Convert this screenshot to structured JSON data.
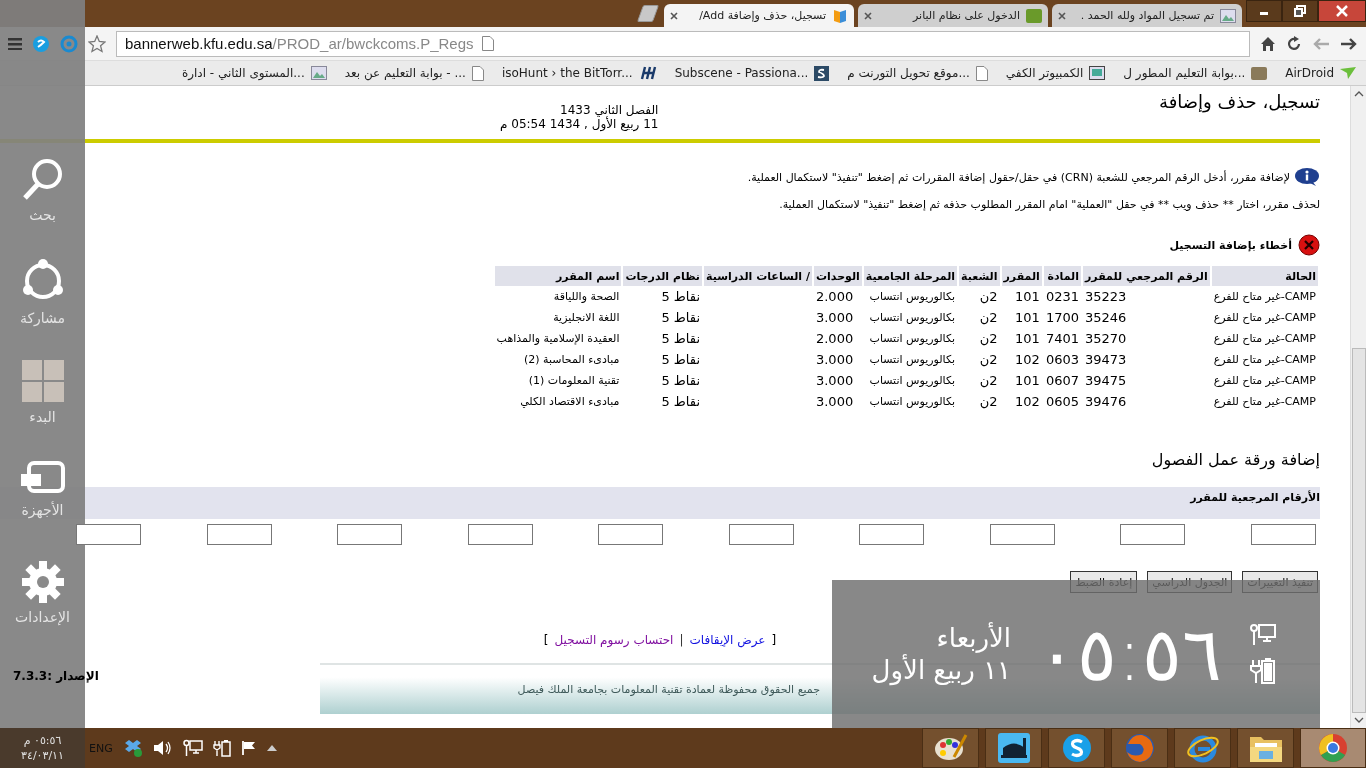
{
  "browser": {
    "tabs": [
      {
        "title": "تم تسجيل المواد ولله الحمد .",
        "selected": false,
        "kind": "image"
      },
      {
        "title": "الدخول على نظام البانر",
        "selected": false,
        "kind": "site"
      },
      {
        "title": "تسجيل، حذف وإضافة Add/",
        "selected": true,
        "kind": "book"
      }
    ],
    "address": {
      "host": "bannerweb.kfu.edu.sa",
      "path": "/PROD_ar/bwckcoms.P_Regs"
    },
    "bookmarks": [
      {
        "title": "AirDroid",
        "kind": "airdroid"
      },
      {
        "title": "بوابة التعليم المطور ل...",
        "kind": "bb"
      },
      {
        "title": "الكمبيوتر الكفي",
        "kind": "tablet"
      },
      {
        "title": "موقع تحويل التورنت م...",
        "kind": "page"
      },
      {
        "title": "Subscene - Passiona...",
        "kind": "subscene"
      },
      {
        "title": "isoHunt › the BitTorr...",
        "kind": "isohunt"
      },
      {
        "title": "بوابة التعليم عن بعد - ...",
        "kind": "page"
      },
      {
        "title": "المستوى الثاني - ادارة...",
        "kind": "image"
      }
    ]
  },
  "page": {
    "title": "تسجيل، حذف وإضافة",
    "term": "الفصل الثاني 1433",
    "date": "11 ربيع الأول , 1434 05:54 م",
    "info": [
      "لإضافة مقرر، أدخل الرقم المرجعي للشعبة (CRN) في حقل/حقول إضافة المقررات ثم إضغط \"تنفيذ\" لاستكمال العملية.",
      "لحذف مقرر، اختار ** حذف ويب ** في حقل \"العملية\" امام المقرر المطلوب حذفه ثم إضغط \"تنفيذ\" لاستكمال العملية."
    ],
    "error_title": "أخطاء بإضافة التسجيل",
    "table": {
      "columns": [
        "الحالة",
        "الرقم المرجعي للمقرر",
        "المادة",
        "المقرر",
        "الشعبة",
        "المرحلة الجامعية",
        "الوحدات",
        "/ الساعات الدراسية",
        "نظام الدرجات",
        "اسم المقرر"
      ],
      "rows": [
        {
          "status": "CAMP-غير متاح للفرع",
          "crn": "35223",
          "subject": "0231",
          "course": "101",
          "section": "2ن",
          "level": "بكالوريوس انتساب",
          "credits": "2.000",
          "grading": "نقاط 5",
          "title": "الصحة واللياقة"
        },
        {
          "status": "CAMP-غير متاح للفرع",
          "crn": "35246",
          "subject": "1700",
          "course": "101",
          "section": "2ن",
          "level": "بكالوريوس انتساب",
          "credits": "3.000",
          "grading": "نقاط 5",
          "title": "اللغة الانجليزية"
        },
        {
          "status": "CAMP-غير متاح للفرع",
          "crn": "35270",
          "subject": "7401",
          "course": "101",
          "section": "2ن",
          "level": "بكالوريوس انتساب",
          "credits": "2.000",
          "grading": "نقاط 5",
          "title": "العقيدة الإسلامية والمذاهب"
        },
        {
          "status": "CAMP-غير متاح للفرع",
          "crn": "39473",
          "subject": "0603",
          "course": "102",
          "section": "2ن",
          "level": "بكالوريوس انتساب",
          "credits": "3.000",
          "grading": "نقاط 5",
          "title": "مبادىء المحاسبة (2)"
        },
        {
          "status": "CAMP-غير متاح للفرع",
          "crn": "39475",
          "subject": "0607",
          "course": "101",
          "section": "2ن",
          "level": "بكالوريوس انتساب",
          "credits": "3.000",
          "grading": "نقاط 5",
          "title": "تقنية المعلومات (1)"
        },
        {
          "status": "CAMP-غير متاح للفرع",
          "crn": "39476",
          "subject": "0605",
          "course": "102",
          "section": "2ن",
          "level": "بكالوريوس انتساب",
          "credits": "3.000",
          "grading": "نقاط 5",
          "title": "مبادىء الاقتصاد الكلي"
        }
      ]
    },
    "worksheet_title": "إضافة ورقة عمل الفصول",
    "crn_label": "الأرقام المرجعية للمقرر",
    "crn_fields": [
      {
        "kind": "text"
      },
      {
        "kind": "text"
      },
      {
        "kind": "text"
      },
      {
        "kind": "text"
      },
      {
        "kind": "text"
      },
      {
        "kind": "text"
      },
      {
        "kind": "text"
      },
      {
        "kind": "text"
      },
      {
        "kind": "text"
      },
      {
        "kind": "text"
      }
    ],
    "buttons": [
      "تنفيذ التغييرات",
      "الجدول الدراسي",
      "إعادة الضبط"
    ],
    "link_bar": {
      "open": "[",
      "separator": "|",
      "close": "]",
      "links": [
        "عرض الإيقافات",
        "احتساب رسوم التسجيل"
      ]
    },
    "release": "الإصدار :7.3.3",
    "footer": "جميع الحقوق محفوظة لعمادة تقنية المعلومات بجامعة الملك فيصل"
  },
  "charms": [
    {
      "label": "بحث",
      "kind": "search"
    },
    {
      "label": "مشاركة",
      "kind": "share"
    },
    {
      "label": "البدء",
      "kind": "start"
    },
    {
      "label": "الأجهزة",
      "kind": "devices"
    },
    {
      "label": "الإعدادات",
      "kind": "settings"
    }
  ],
  "clock_overlay": {
    "time": "٠٥:٥٦",
    "day": "الأربعاء",
    "date": "١١ ربيع الأول"
  },
  "taskbar": {
    "time": "٠٥:٥٦ م",
    "date": "٣٤/٠٣/١١",
    "language": "ENG"
  }
}
